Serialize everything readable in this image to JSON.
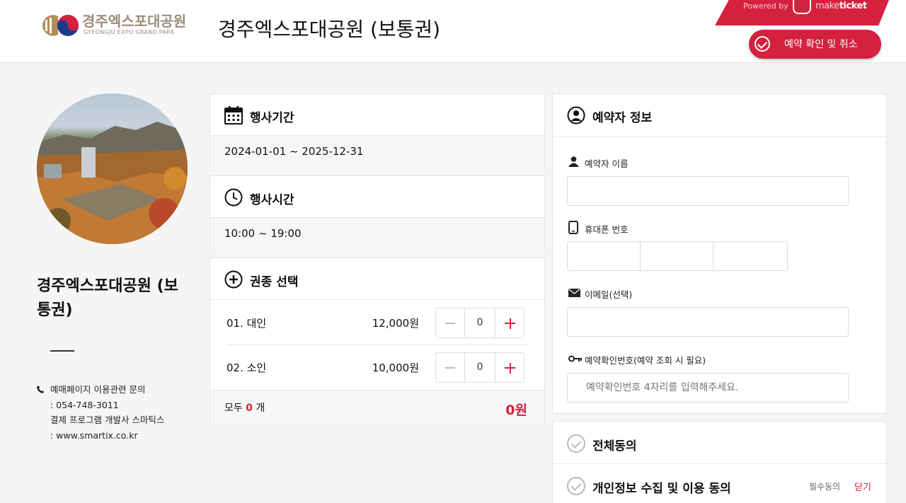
{
  "header": {
    "logo_ko": "경주엑스포대공원",
    "logo_en": "GYEONGJU EXPO GRAND PARK",
    "title": "경주엑스포대공원 (보통권)",
    "powered_by": "Powered by",
    "brand_make": "make",
    "brand_ticket": "ticket",
    "confirm_button": "예약 확인 및 취소"
  },
  "sidebar": {
    "event_name": "경주엑스포대공원 (보통권)",
    "contact_lines": [
      "예매페이지 이용관련 문의",
      ": 054-748-3011",
      "결제 프로그램 개발사 스마틱스",
      ": www.smartix.co.kr"
    ]
  },
  "period": {
    "title": "행사기간",
    "value": "2024-01-01 ~ 2025-12-31"
  },
  "hours": {
    "title": "행사시간",
    "value": "10:00 ~ 19:00"
  },
  "tickets": {
    "title": "권종 선택",
    "items": [
      {
        "name": "01. 대인",
        "price": "12,000원",
        "qty": "0"
      },
      {
        "name": "02. 소인",
        "price": "10,000원",
        "qty": "0"
      }
    ],
    "total_prefix": "모두",
    "total_count": "0",
    "total_suffix": "개",
    "total_amount": "0원"
  },
  "booker": {
    "title": "예약자 정보",
    "name_label": "예약자 이름",
    "phone_label": "휴대폰 번호",
    "email_label": "이메일(선택)",
    "pin_label": "예약확인번호(예약 조회 시 필요)",
    "pin_placeholder": "예약확인번호 4자리를 입력해주세요."
  },
  "agreements": {
    "all": "전체동의",
    "privacy": "개인정보 수집 및 이용 동의",
    "required": "필수동의",
    "close": "닫기"
  },
  "colors": {
    "accent": "#d4213f",
    "background": "#f5f5f5"
  }
}
